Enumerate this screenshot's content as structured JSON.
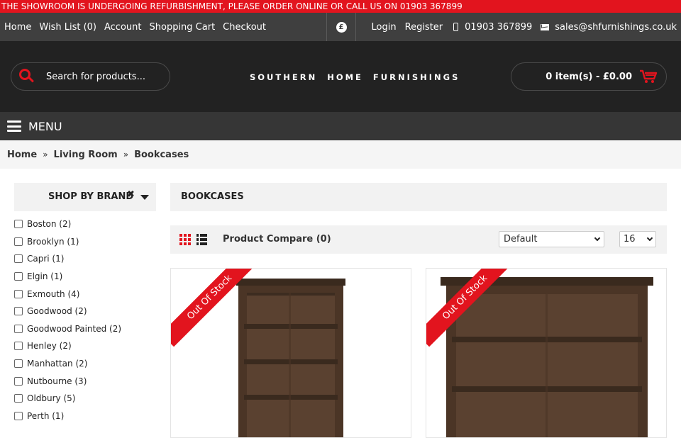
{
  "notice": "THE SHOWROOM IS UNDERGOING REFURBISHMENT, PLEASE ORDER ONLINE OR CALL US ON 01903 367899",
  "topbar": {
    "links": [
      "Home",
      "Wish List (0)",
      "Account",
      "Shopping Cart",
      "Checkout"
    ],
    "currency_symbol": "£",
    "login": "Login",
    "register": "Register",
    "phone": "01903 367899",
    "email": "sales@shfurnishings.co.uk",
    "phone_icon": "phone-icon",
    "email_icon": "envelope-icon"
  },
  "header": {
    "search_placeholder": "Search for products...",
    "logo_text": "SOUTHERN HOME FURNISHINGS",
    "cart_label": "0 item(s) - £0.00",
    "accent_color": "#e2141e"
  },
  "menu": {
    "label": "MENU"
  },
  "breadcrumb": [
    "Home",
    "Living Room",
    "Bookcases"
  ],
  "sidebar": {
    "brand_title": "SHOP BY BRAND",
    "clear_glyph": "✖",
    "brands": [
      "Boston (2)",
      "Brooklyn (1)",
      "Capri (1)",
      "Elgin (1)",
      "Exmouth (4)",
      "Goodwood (2)",
      "Goodwood Painted (2)",
      "Henley (2)",
      "Manhattan (2)",
      "Nutbourne (3)",
      "Oldbury (5)",
      "Perth (1)"
    ]
  },
  "category": {
    "title": "BOOKCASES",
    "compare": "Product Compare (0)",
    "sort_value": "Default",
    "limit_value": "16"
  },
  "products": [
    {
      "badge": "Out Of Stock"
    },
    {
      "badge": "Out Of Stock"
    }
  ]
}
